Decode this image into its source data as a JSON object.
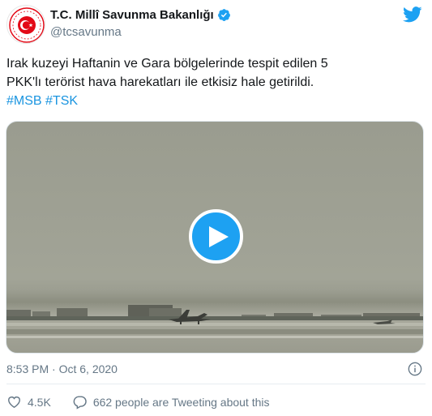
{
  "author": {
    "name": "T.C. Millî Savunma Bakanlığı",
    "handle": "@tcsavunma",
    "avatar_icon": "ministry-emblem-icon",
    "verified_icon": "verified-badge-icon"
  },
  "tweet": {
    "text_line1": "Irak kuzeyi Haftanin ve Gara bölgelerinde tespit edilen 5",
    "text_line2": "PKK'lı terörist hava harekatları ile etkisiz hale getirildi.",
    "hashtags": [
      "#MSB",
      "#TSK"
    ],
    "timestamp": "8:53 PM · Oct 6, 2020"
  },
  "media": {
    "type": "video",
    "play_icon": "play-icon"
  },
  "actions": {
    "likes": "4.5K",
    "conversation": "662 people are Tweeting about this"
  },
  "colors": {
    "accent": "#1da1f2",
    "link": "#1b95e0",
    "secondary_text": "#657786",
    "emblem_red": "#e30a17"
  }
}
